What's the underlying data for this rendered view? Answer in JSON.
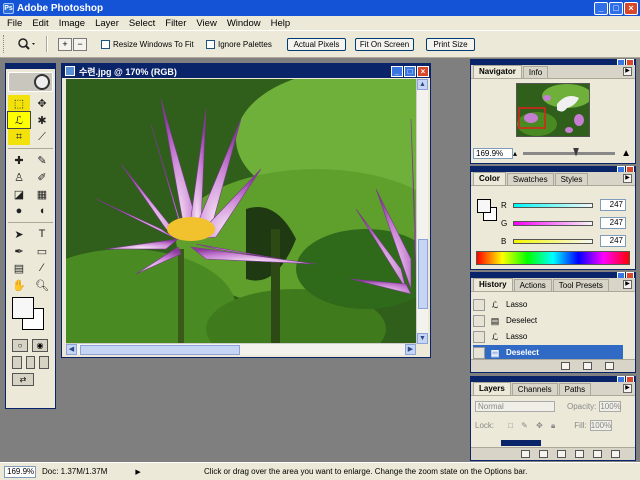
{
  "window": {
    "title": "Adobe Photoshop",
    "icon": "Ps",
    "min": "_",
    "max": "□",
    "close": "×"
  },
  "menu": [
    "File",
    "Edit",
    "Image",
    "Layer",
    "Select",
    "Filter",
    "View",
    "Window",
    "Help"
  ],
  "options": {
    "zoom_in": "+",
    "zoom_out": "−",
    "resize_windows": "Resize Windows To Fit",
    "ignore_palettes": "Ignore Palettes",
    "actual_pixels": "Actual Pixels",
    "fit_on_screen": "Fit On Screen",
    "print_size": "Print Size"
  },
  "document": {
    "title": "수련.jpg @ 170% (RGB)",
    "up": "▲",
    "down": "▼",
    "left": "◀",
    "right": "▶"
  },
  "navigator": {
    "tabs": [
      "Navigator",
      "Info"
    ],
    "zoom": "169.9%",
    "menu_arrow": "▶"
  },
  "color": {
    "tabs": [
      "Color",
      "Swatches",
      "Styles"
    ],
    "rows": [
      {
        "label": "R",
        "value": "247",
        "gradient": "linear-gradient(to right,#00f7f7,#f7f7f7)"
      },
      {
        "label": "G",
        "value": "247",
        "gradient": "linear-gradient(to right,#f700f7,#f7f7f7)"
      },
      {
        "label": "B",
        "value": "247",
        "gradient": "linear-gradient(to right,#f7f700,#f7f7f7)"
      }
    ]
  },
  "history": {
    "tabs": [
      "History",
      "Actions",
      "Tool Presets"
    ],
    "items": [
      {
        "label": "Lasso",
        "icon": "lasso-icon",
        "glyph": "ℒ"
      },
      {
        "label": "Deselect",
        "icon": "deselect-icon",
        "glyph": "▤"
      },
      {
        "label": "Lasso",
        "icon": "lasso-icon",
        "glyph": "ℒ"
      },
      {
        "label": "Deselect",
        "icon": "deselect-icon",
        "glyph": "▤"
      }
    ]
  },
  "layers": {
    "tabs": [
      "Layers",
      "Channels",
      "Paths"
    ],
    "blend_mode": "Normal",
    "opacity_label": "Opacity:",
    "opacity": "100%",
    "lock_label": "Lock:",
    "fill_label": "Fill:",
    "fill": "100%"
  },
  "status": {
    "zoom": "169.9%",
    "doc": "Doc: 1.37M/1.37M",
    "arrow": "▶",
    "message": "Click or drag over the area you want to enlarge. Change the zoom state on the Options bar."
  },
  "colors": {
    "title_blue": "#1553d6",
    "panel": "#ece9d8",
    "dark_blue": "#0a246a",
    "selection": "#316ac5",
    "highlight_yellow": "#f2e20a"
  }
}
